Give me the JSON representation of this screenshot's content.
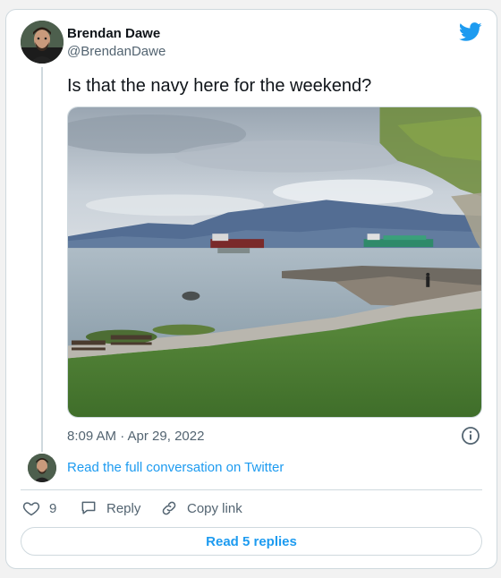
{
  "author": {
    "name": "Brendan Dawe",
    "handle": "@BrendanDawe"
  },
  "tweet": {
    "text": "Is that the navy here for the weekend?",
    "timestamp": "8:09 AM · Apr 29, 2022"
  },
  "conversation": {
    "link_text": "Read the full conversation on Twitter"
  },
  "actions": {
    "like_count": "9",
    "reply_label": "Reply",
    "copy_label": "Copy link"
  },
  "footer": {
    "read_replies_label": "Read 5 replies"
  },
  "icons": {
    "brand": "twitter-bird-icon",
    "info": "info-icon",
    "like": "heart-icon",
    "reply": "speech-bubble-icon",
    "copy": "link-icon"
  },
  "colors": {
    "accent": "#1d9bf0",
    "text": "#0f1419",
    "secondary": "#536471",
    "border": "#cfd9de"
  }
}
